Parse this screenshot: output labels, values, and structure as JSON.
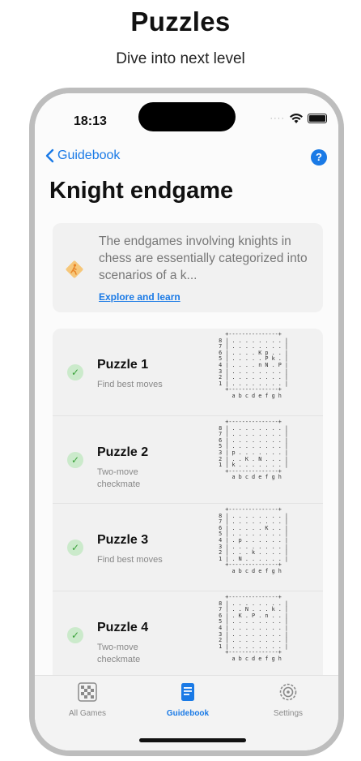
{
  "promo": {
    "headline": "Puzzles",
    "subline": "Dive into next level"
  },
  "status_bar": {
    "time": "18:13"
  },
  "nav": {
    "back_label": "Guidebook",
    "help_label": "?"
  },
  "page": {
    "title": "Knight endgame"
  },
  "info_card": {
    "text": "The endgames involving knights in chess are essentially categorized into scenarios of a k...",
    "link": "Explore and learn"
  },
  "puzzles": [
    {
      "title": "Puzzle 1",
      "subtitle": "Find best moves",
      "done": true,
      "board": "   +---------------+\n 8 | . . . . . . . . |\n 7 | . . . . . . . . |\n 6 | . . . . K p . . |\n 5 | . . . . . P k . |\n 4 | . . . . n N . P |\n 3 | . . . . . . . . |\n 2 | . . . . . . . . |\n 1 | . . . . . . . . |\n   +---------------+\n     a b c d e f g h"
    },
    {
      "title": "Puzzle 2",
      "subtitle": "Two-move checkmate",
      "done": true,
      "board": "   +---------------+\n 8 | . . . . . . . . |\n 7 | . . . . . . . . |\n 6 | . . . . . . . . |\n 5 | . . . . . . . . |\n 3 | p . . . . . . . |\n 2 | . . K . N . . . |\n 1 | k . . . . . . . |\n   +---------------+\n     a b c d e f g h"
    },
    {
      "title": "Puzzle 3",
      "subtitle": "Find best moves",
      "done": true,
      "board": "   +---------------+\n 8 | . . . . . . . . |\n 7 | . . . . . . . . |\n 6 | . . . . . K . . |\n 5 | . . . . . . . . |\n 4 | . p . . . . . . |\n 3 | . . . . . . . . |\n 2 | . . . k . . . . |\n 1 | . N . . . . . . |\n   +---------------+\n     a b c d e f g h"
    },
    {
      "title": "Puzzle 4",
      "subtitle": "Two-move checkmate",
      "done": true,
      "board": "   +---------------+\n 8 | . . . . . . . . |\n 7 | . . N . . . k . |\n 6 | . K . P . n . . |\n 5 | . . . . . . . . |\n 4 | . . . . . . . . |\n 3 | . . . . . . . . |\n 2 | . . . . . . . . |\n 1 | . . . . . . . . |\n   +---------------+\n     a b c d e f g h"
    }
  ],
  "tabs": [
    {
      "label": "All Games",
      "icon": "chessboard-icon",
      "active": false
    },
    {
      "label": "Guidebook",
      "icon": "book-icon",
      "active": true
    },
    {
      "label": "Settings",
      "icon": "gear-icon",
      "active": false
    }
  ],
  "colors": {
    "accent": "#1a7ae6",
    "check_bg": "#cbeacb",
    "check_fg": "#3aa23a",
    "card_bg": "#f1f1f1"
  }
}
